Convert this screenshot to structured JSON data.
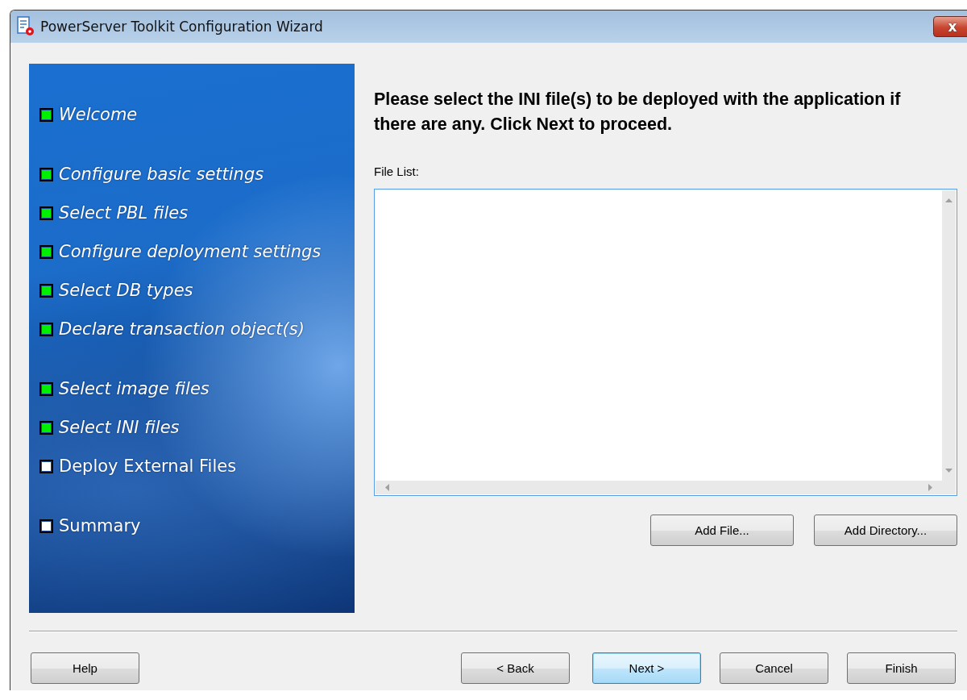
{
  "window": {
    "title": "PowerServer Toolkit Configuration Wizard",
    "close": "x"
  },
  "steps": [
    [
      {
        "label": "Welcome",
        "done": true
      }
    ],
    [
      {
        "label": "Configure basic settings",
        "done": true
      },
      {
        "label": "Select PBL files",
        "done": true
      },
      {
        "label": "Configure deployment settings",
        "done": true
      },
      {
        "label": "Select DB types",
        "done": true
      },
      {
        "label": "Declare transaction object(s)",
        "done": true
      }
    ],
    [
      {
        "label": "Select image files",
        "done": true
      },
      {
        "label": "Select INI files",
        "done": true
      },
      {
        "label": "Deploy External Files",
        "done": false
      }
    ],
    [
      {
        "label": "Summary",
        "done": false
      }
    ]
  ],
  "heading": "Please select the INI file(s) to be deployed with the application if there are any. Click Next to proceed.",
  "file_list": {
    "label": "File List:"
  },
  "list_buttons": [
    "Add File...",
    "Add Directory..."
  ],
  "footer_buttons": [
    {
      "label": "Help",
      "kind": "left"
    },
    {
      "label": "< Back",
      "kind": "normal"
    },
    {
      "label": "Next >",
      "kind": "default"
    },
    {
      "label": "Cancel",
      "kind": "normal"
    },
    {
      "label": "Finish",
      "kind": "normal"
    }
  ]
}
